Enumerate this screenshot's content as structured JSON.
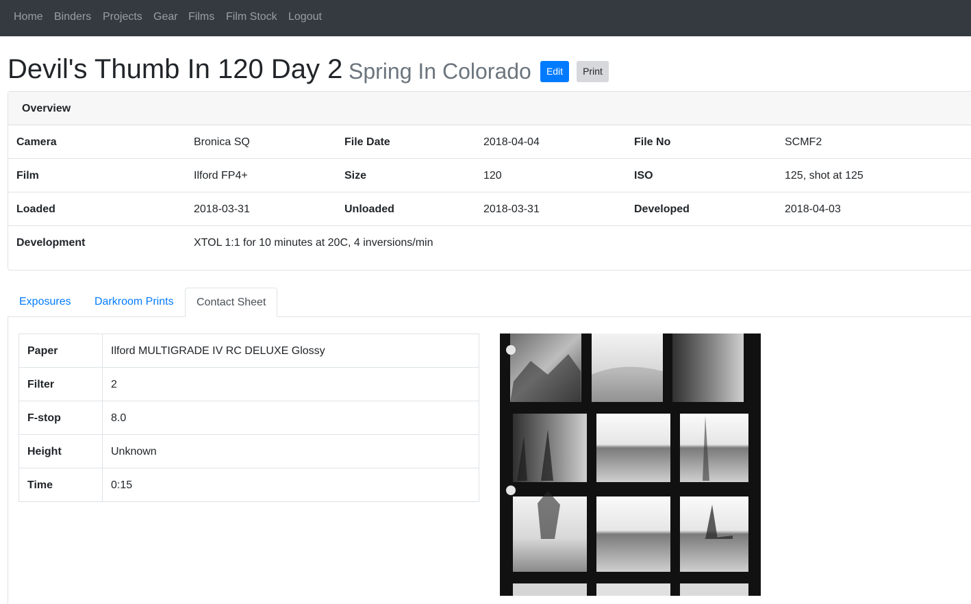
{
  "nav": {
    "items": [
      {
        "label": "Home"
      },
      {
        "label": "Binders"
      },
      {
        "label": "Projects"
      },
      {
        "label": "Gear"
      },
      {
        "label": "Films"
      },
      {
        "label": "Film Stock"
      },
      {
        "label": "Logout"
      }
    ]
  },
  "header": {
    "title": "Devil's Thumb In 120 Day 2",
    "subtitle": "Spring In Colorado",
    "edit_label": "Edit",
    "print_label": "Print"
  },
  "overview": {
    "heading": "Overview",
    "rows": [
      [
        {
          "label": "Camera",
          "value": "Bronica SQ"
        },
        {
          "label": "File Date",
          "value": "2018-04-04"
        },
        {
          "label": "File No",
          "value": "SCMF2"
        }
      ],
      [
        {
          "label": "Film",
          "value": "Ilford FP4+"
        },
        {
          "label": "Size",
          "value": "120"
        },
        {
          "label": "ISO",
          "value": "125, shot at 125"
        }
      ],
      [
        {
          "label": "Loaded",
          "value": "2018-03-31"
        },
        {
          "label": "Unloaded",
          "value": "2018-03-31"
        },
        {
          "label": "Developed",
          "value": "2018-04-03"
        }
      ]
    ],
    "development": {
      "label": "Development",
      "value": "XTOL 1:1 for 10 minutes at 20C, 4 inversions/min"
    }
  },
  "tabs": [
    {
      "label": "Exposures",
      "active": false
    },
    {
      "label": "Darkroom Prints",
      "active": false
    },
    {
      "label": "Contact Sheet",
      "active": true
    }
  ],
  "contact_sheet": {
    "rows": [
      {
        "label": "Paper",
        "value": "Ilford MULTIGRADE IV RC DELUXE Glossy"
      },
      {
        "label": "Filter",
        "value": "2"
      },
      {
        "label": "F-stop",
        "value": "8.0"
      },
      {
        "label": "Height",
        "value": "Unknown"
      },
      {
        "label": "Time",
        "value": "0:15"
      }
    ]
  },
  "colors": {
    "navbar": "#343a40",
    "primary": "#007bff",
    "muted": "#6c757d",
    "border": "#dee2e6"
  }
}
